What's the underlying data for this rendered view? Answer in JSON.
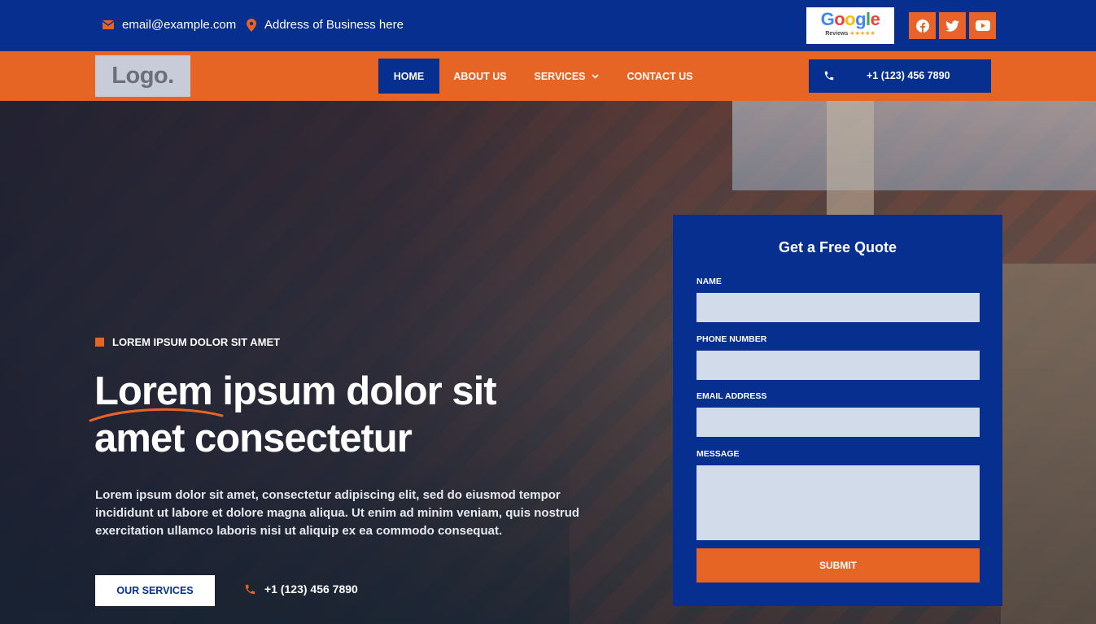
{
  "topbar": {
    "email": "email@example.com",
    "address": "Address of Business here",
    "google_badge": {
      "word": "Google",
      "sub": "Reviews",
      "stars": "★★★★★"
    },
    "social": [
      "facebook-icon",
      "twitter-icon",
      "youtube-icon"
    ]
  },
  "nav": {
    "logo": "Logo.",
    "items": [
      {
        "label": "HOME",
        "active": true
      },
      {
        "label": "ABOUT US"
      },
      {
        "label": "SERVICES"
      },
      {
        "label": "CONTACT US"
      }
    ],
    "phone": "+1 (123) 456 7890"
  },
  "hero": {
    "eyebrow": "LOREM IPSUM DOLOR SIT AMET",
    "headline_line1": "Lorem ipsum dolor sit",
    "headline_line2": "amet consectetur",
    "body": "Lorem ipsum dolor sit amet, consectetur adipiscing elit, sed do eiusmod tempor incididunt ut labore et dolore magna aliqua. Ut enim ad minim veniam, quis nostrud exercitation ullamco laboris nisi ut aliquip ex ea commodo consequat.",
    "cta_label": "OUR SERVICES",
    "phone": "+1 (123) 456 7890"
  },
  "quote_form": {
    "title": "Get a Free Quote",
    "fields": [
      {
        "label": "NAME",
        "value": ""
      },
      {
        "label": "PHONE NUMBER",
        "value": ""
      },
      {
        "label": "EMAIL ADDRESS",
        "value": ""
      },
      {
        "label": "MESSAGE",
        "value": ""
      }
    ],
    "submit_label": "SUBMIT"
  },
  "colors": {
    "navy": "#062f8f",
    "orange": "#e66525",
    "field_bg": "#d2dbea",
    "white": "#ffffff"
  }
}
